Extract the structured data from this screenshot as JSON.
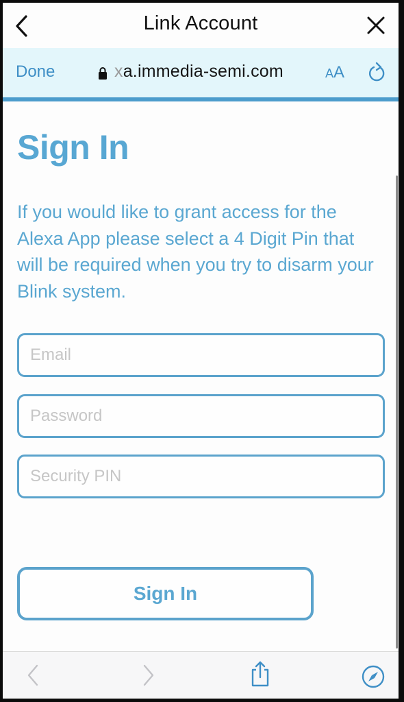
{
  "header": {
    "title": "Link Account",
    "back_icon": "chevron-left-icon",
    "close_icon": "close-icon"
  },
  "urlbar": {
    "done_label": "Done",
    "lock_icon": "lock-icon",
    "url_faded_prefix": "x",
    "url_text": "a.immedia-semi.com",
    "text_size_small": "A",
    "text_size_big": "A",
    "reload_icon": "reload-icon"
  },
  "page": {
    "heading": "Sign In",
    "description": "If you would like to grant access for the Alexa App please select a 4 Digit Pin that will be required when you try to disarm your Blink system.",
    "fields": {
      "email": {
        "placeholder": "Email",
        "value": ""
      },
      "password": {
        "placeholder": "Password",
        "value": ""
      },
      "pin": {
        "placeholder": "Security PIN",
        "value": ""
      }
    },
    "signin_button_label": "Sign In"
  },
  "toolbar": {
    "back_icon": "chevron-left-icon",
    "forward_icon": "chevron-right-icon",
    "share_icon": "share-icon",
    "compass_icon": "compass-icon"
  },
  "colors": {
    "accent": "#5aa7d1",
    "border": "#5ba3cc",
    "urlbar_bg": "#e3f6fb",
    "link_blue": "#3f8fc6",
    "progress_line": "#4c9ccc"
  }
}
